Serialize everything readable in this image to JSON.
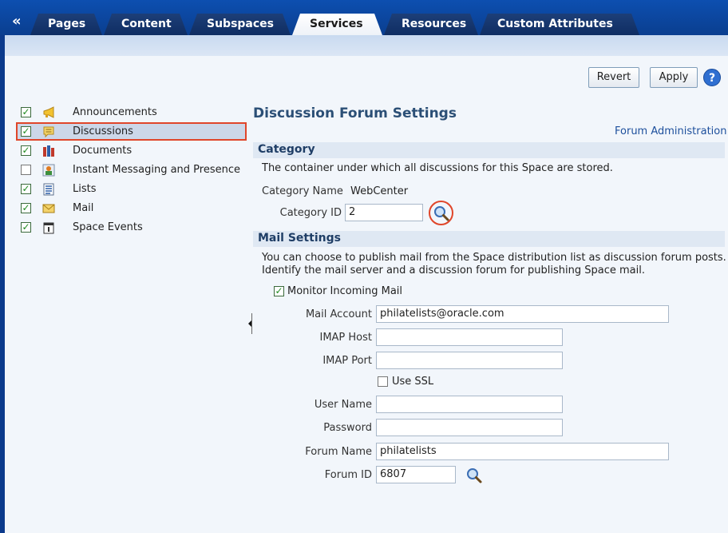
{
  "tabs": [
    {
      "label": "Pages"
    },
    {
      "label": "Content"
    },
    {
      "label": "Subspaces"
    },
    {
      "label": "Services"
    },
    {
      "label": "Resources"
    },
    {
      "label": "Custom Attributes"
    }
  ],
  "collapse_label": "«",
  "toolbar": {
    "revert_label": "Revert",
    "apply_label": "Apply",
    "help_label": "?"
  },
  "services": [
    {
      "label": "Announcements",
      "checked": true,
      "icon": "megaphone-icon"
    },
    {
      "label": "Discussions",
      "checked": true,
      "icon": "speech-bubble-icon"
    },
    {
      "label": "Documents",
      "checked": true,
      "icon": "books-icon"
    },
    {
      "label": "Instant Messaging and Presence",
      "checked": false,
      "icon": "presence-icon"
    },
    {
      "label": "Lists",
      "checked": true,
      "icon": "list-icon"
    },
    {
      "label": "Mail",
      "checked": true,
      "icon": "envelope-icon"
    },
    {
      "label": "Space Events",
      "checked": true,
      "icon": "calendar-icon"
    }
  ],
  "check_glyph": "✓",
  "page": {
    "title": "Discussion Forum Settings",
    "forum_admin_link": "Forum Administration"
  },
  "category": {
    "heading": "Category",
    "description": "The container under which all discussions for this Space are stored.",
    "name_label": "Category Name",
    "name_value": "WebCenter",
    "id_label": "Category ID",
    "id_value": "2"
  },
  "mail": {
    "heading": "Mail Settings",
    "description_line1": "You can choose to publish mail from the Space distribution list as discussion forum posts.",
    "description_line2": "Identify the mail server and a discussion forum for publishing Space mail.",
    "monitor_label": "Monitor Incoming Mail",
    "monitor_checked": true,
    "account_label": "Mail Account",
    "account_value": "philatelists@oracle.com",
    "imap_host_label": "IMAP Host",
    "imap_host_value": "",
    "imap_port_label": "IMAP Port",
    "imap_port_value": "",
    "ssl_label": "Use SSL",
    "ssl_checked": false,
    "user_label": "User Name",
    "user_value": "",
    "password_label": "Password",
    "password_value": "",
    "forum_name_label": "Forum Name",
    "forum_name_value": "philatelists",
    "forum_id_label": "Forum ID",
    "forum_id_value": "6807"
  },
  "colors": {
    "tabbar": "#0d4fb0",
    "highlight": "#e0462a",
    "section_bg": "#dfe8f3",
    "title": "#2b4f76"
  }
}
